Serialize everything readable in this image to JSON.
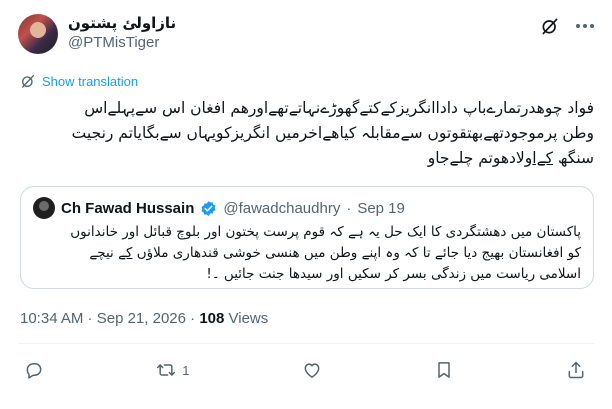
{
  "author": {
    "display_name": "نازاولئ پشتون",
    "handle": "@PTMisTiger"
  },
  "translate": {
    "label": "Show translation"
  },
  "tweet": {
    "line1": "فواد چوھدرتمارےباپ داداانگریزکےکتےگھوڑےنہاتےتھےاورھم افغان اس سےپہلےاس",
    "line2": "وطن پرموجودتھےبھتقوتوں سےمقابلہ کیاھےاخرمیں انگریزکویہاں سےبگایاتم رنجیت",
    "line3_a": "سنگھ ",
    "line3_ul": "کےا",
    "line3_b": "ولادھوتم چلےجاو"
  },
  "quote": {
    "name": "Ch Fawad Hussain",
    "handle": "@fawadchaudhry",
    "separator": "·",
    "date": "Sep 19",
    "line1": "پاکستان میں دھشتگردی کا ایک حل یہ ہے کہ قوم پرست پختون اور بلوچ قبائل اور خاندانوں",
    "line2_a": "کو افغانستان بھیج دیا جائے تا کہ وہ اپنے وطن میں ھنسی خوشی قندھاری ملاؤں ",
    "line2_ul": "کے",
    "line2_b": " نیچے",
    "line3": "اسلامی ریاست میں زندگی بسر کر سکیں  اور سیدھا جنت جائیں ۔!"
  },
  "meta": {
    "time": "10:34 AM",
    "separator1": " · ",
    "date": "Sep 21, 2026",
    "separator2": " · ",
    "views_count": "108",
    "views_label": " Views"
  },
  "actions": {
    "retweet_count": "1"
  },
  "colors": {
    "accent": "#1d9bf0",
    "secondary_text": "#536471",
    "border": "#cfd9de"
  },
  "icons": [
    "grok-icon",
    "more-icon",
    "translate-icon",
    "verified-icon",
    "reply-icon",
    "retweet-icon",
    "like-icon",
    "bookmark-icon",
    "share-icon"
  ]
}
